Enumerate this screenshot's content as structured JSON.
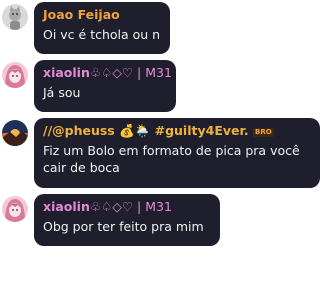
{
  "messages": [
    {
      "author": "Joao Feijao",
      "text": "Oi vc é tchola ou n",
      "avatar": "gray-cat-avatar",
      "name_color": "#f2a23c"
    },
    {
      "author": "xiaolin",
      "author_suffix": "♧♤◇♡ | M31",
      "text": "Já sou",
      "avatar": "anime-girl-avatar",
      "name_color": "#e58bd6"
    },
    {
      "author": "//@pheuss",
      "author_emojis": "💰🌦️",
      "author_tag": "#guilty4Ever.",
      "badge": "BRO",
      "text": "Fiz um Bolo em formato de pica pra você cair de boca",
      "avatar": "sunset-avatar",
      "name_color": "#f0b23a"
    },
    {
      "author": "xiaolin",
      "author_suffix": "♧♤◇♡ | M31",
      "text": "Obg por ter feito pra mim",
      "avatar": "anime-girl-avatar",
      "name_color": "#e58bd6"
    }
  ]
}
